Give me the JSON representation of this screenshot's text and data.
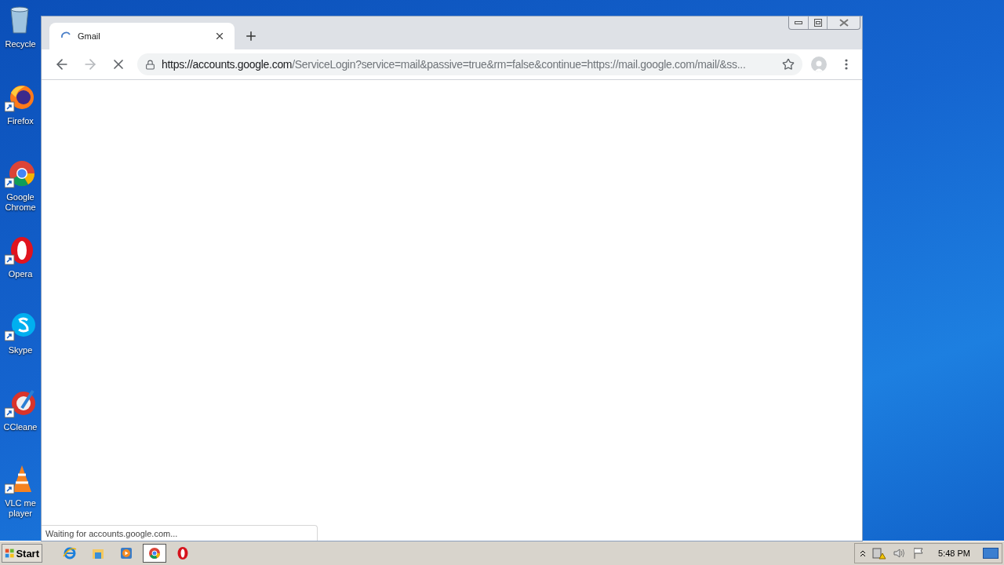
{
  "desktop_icons": [
    {
      "kind": "recycle",
      "label": "Recycle"
    },
    {
      "kind": "firefox",
      "label": "Firefox"
    },
    {
      "kind": "chrome",
      "label": "Google Chrome"
    },
    {
      "kind": "opera",
      "label": "Opera"
    },
    {
      "kind": "skype",
      "label": "Skype"
    },
    {
      "kind": "ccleaner",
      "label": "CCleane"
    },
    {
      "kind": "vlc",
      "label": "VLC me player"
    }
  ],
  "browser": {
    "tabs": [
      {
        "title": "Gmail",
        "selected": true,
        "loading": true
      }
    ],
    "nav_buttons": [
      {
        "kind": "back",
        "disabled": false
      },
      {
        "kind": "forward",
        "disabled": true
      },
      {
        "kind": "stop",
        "disabled": false
      }
    ],
    "address": {
      "host": "https://accounts.google.com",
      "path": "/ServiceLogin?service=mail&passive=true&rm=false&continue=https://mail.google.com/mail/&ss..."
    },
    "status": "Waiting for accounts.google.com..."
  },
  "taskbar": {
    "start": "Start",
    "apps": [
      {
        "kind": "ie",
        "selected": false
      },
      {
        "kind": "explorer",
        "selected": false
      },
      {
        "kind": "media",
        "selected": false
      },
      {
        "kind": "chrome",
        "selected": true
      },
      {
        "kind": "opera",
        "selected": false
      }
    ],
    "clock": "5:48 PM"
  }
}
